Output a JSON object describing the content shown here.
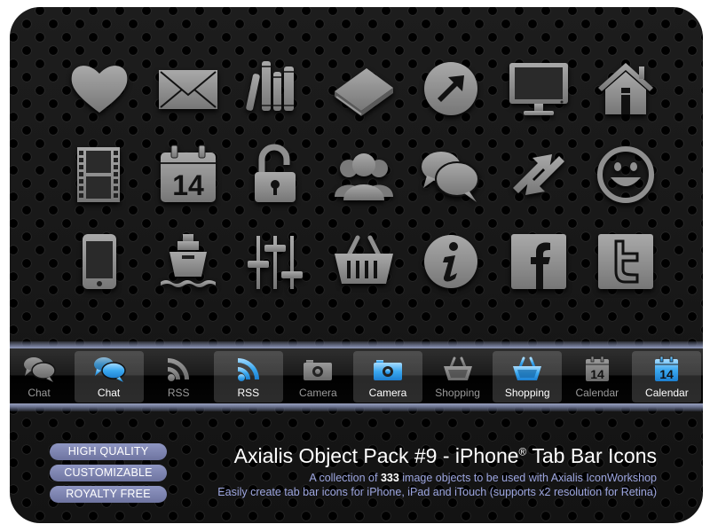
{
  "grid_icons": [
    {
      "name": "heart-icon"
    },
    {
      "name": "mail-icon"
    },
    {
      "name": "books-icon"
    },
    {
      "name": "book-icon"
    },
    {
      "name": "arrow-circle-icon"
    },
    {
      "name": "monitor-icon"
    },
    {
      "name": "home-icon"
    },
    {
      "name": "film-icon"
    },
    {
      "name": "calendar-icon",
      "text": "14"
    },
    {
      "name": "unlock-icon"
    },
    {
      "name": "users-icon"
    },
    {
      "name": "chat-icon"
    },
    {
      "name": "sync-arrows-icon"
    },
    {
      "name": "smiley-icon"
    },
    {
      "name": "phone-icon"
    },
    {
      "name": "ship-icon"
    },
    {
      "name": "sliders-icon"
    },
    {
      "name": "basket-icon"
    },
    {
      "name": "info-icon",
      "text": "i"
    },
    {
      "name": "facebook-icon",
      "text": "f"
    },
    {
      "name": "twitter-icon",
      "text": "t"
    }
  ],
  "tabbar": {
    "tabs": [
      {
        "label": "Chat",
        "icon": "chat",
        "active": false
      },
      {
        "label": "Chat",
        "icon": "chat",
        "active": true
      },
      {
        "label": "RSS",
        "icon": "rss",
        "active": false
      },
      {
        "label": "RSS",
        "icon": "rss",
        "active": true
      },
      {
        "label": "Camera",
        "icon": "camera",
        "active": false
      },
      {
        "label": "Camera",
        "icon": "camera",
        "active": true
      },
      {
        "label": "Shopping",
        "icon": "basket",
        "active": false
      },
      {
        "label": "Shopping",
        "icon": "basket",
        "active": true
      },
      {
        "label": "Calendar",
        "icon": "calendar",
        "active": false
      },
      {
        "label": "Calendar",
        "icon": "calendar",
        "active": true
      }
    ],
    "calendar_day": "14",
    "inactive_color": "#8a8a8a",
    "active_color": "#3aa8f0"
  },
  "badges": [
    "HIGH QUALITY",
    "CUSTOMIZABLE",
    "ROYALTY FREE"
  ],
  "title": {
    "main": "Axialis Object Pack #9 - iPhone",
    "reg": "®",
    "suffix": " Tab Bar Icons"
  },
  "subtitle1": {
    "pre": "A collection of ",
    "count": "333",
    "post": " image objects to be used with Axialis IconWorkshop"
  },
  "subtitle2": "Easily create tab bar icons for iPhone, iPad and iTouch (supports x2 resolution for Retina)"
}
